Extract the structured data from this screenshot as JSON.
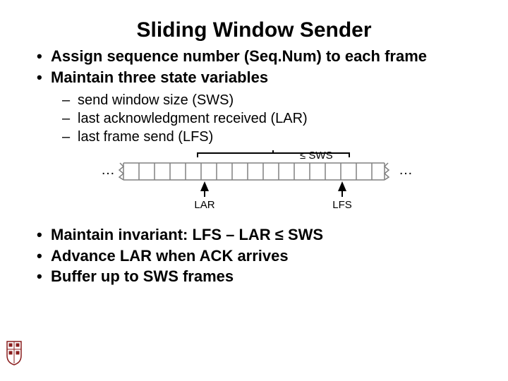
{
  "title": "Sliding Window Sender",
  "bullets1": {
    "b0": "Assign sequence number (Seq.Num) to each frame",
    "b1": "Maintain three state variables"
  },
  "sub": {
    "s0": "send window size (SWS)",
    "s1": "last acknowledgment received (LAR)",
    "s2": "last frame send (LFS)"
  },
  "bullets2": {
    "b0": "Maintain invariant: LFS – LAR ≤ SWS",
    "b1": "Advance LAR when ACK arrives",
    "b2": "Buffer up to SWS frames"
  },
  "diagram": {
    "ellipsis_left": "…",
    "ellipsis_right": "…",
    "brace_label": "≤ SWS",
    "pointer_left": "LAR",
    "pointer_right": "LFS"
  }
}
